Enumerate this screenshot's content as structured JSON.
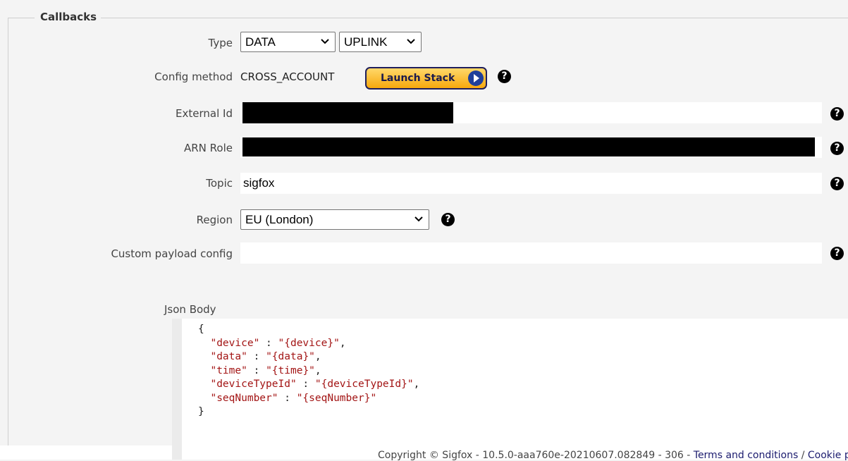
{
  "fieldset": {
    "legend": "Callbacks"
  },
  "form": {
    "type": {
      "label": "Type",
      "select1": "DATA",
      "select2": "UPLINK"
    },
    "config_method": {
      "label": "Config method",
      "value": "CROSS_ACCOUNT",
      "launch_label": "Launch Stack"
    },
    "external_id": {
      "label": "External Id"
    },
    "arn_role": {
      "label": "ARN Role"
    },
    "topic": {
      "label": "Topic",
      "value": "sigfox"
    },
    "region": {
      "label": "Region",
      "value": "EU (London)"
    },
    "custom_payload": {
      "label": "Custom payload config",
      "value": ""
    },
    "json_body": {
      "label": "Json Body",
      "lines": [
        {
          "key": "",
          "val": "{"
        },
        {
          "key": "\"device\"",
          "val": "\"{device}\","
        },
        {
          "key": "\"data\"",
          "val": "\"{data}\","
        },
        {
          "key": "\"time\"",
          "val": "\"{time}\","
        },
        {
          "key": "\"deviceTypeId\"",
          "val": "\"{deviceTypeId}\","
        },
        {
          "key": "\"seqNumber\"",
          "val": "\"{seqNumber}\""
        },
        {
          "key": "",
          "val": "}"
        }
      ]
    }
  },
  "help_symbol": "?",
  "footer": {
    "prefix": "Copyright © Sigfox - 10.5.0-aaa760e-20210607.082849 - 306 - ",
    "terms": "Terms and conditions",
    "sep": " / ",
    "cookie": "Cookie policy"
  }
}
